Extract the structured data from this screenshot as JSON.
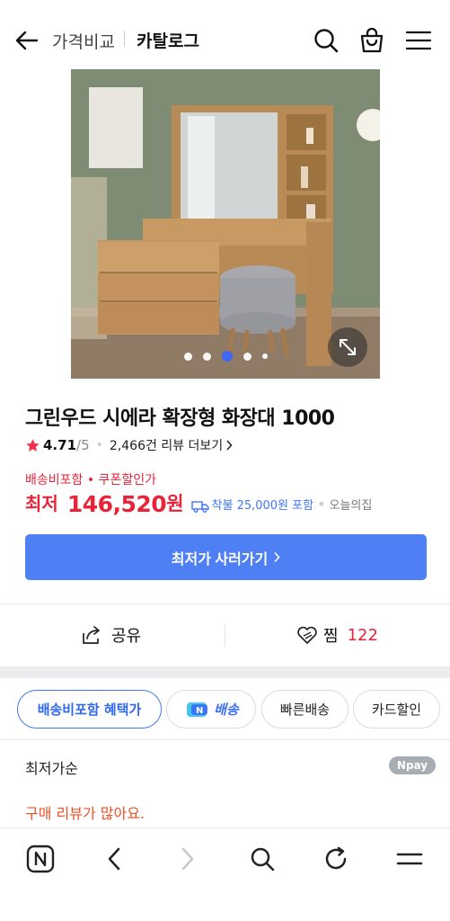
{
  "header": {
    "back_label": "back",
    "crumb_parent": "가격비교",
    "crumb_current": "카탈로그"
  },
  "product": {
    "image_alt": "vanity dresser with stool",
    "carousel_pages": 5,
    "carousel_current": 3,
    "title": "그린우드 시에라 확장형 화장대 1000",
    "rating": "4.71",
    "rating_max": "/5",
    "review_text": "2,466건 리뷰 더보기"
  },
  "price": {
    "note": "배송비포함 • 쿠폰할인가",
    "label": "최저",
    "value": "146,520",
    "unit": "원",
    "shipping": "착불 25,000원 포함",
    "ship_today": "오늘의집",
    "cta_label": "최저가 사러가기"
  },
  "actions": {
    "share_label": "공유",
    "wish_label": "찜",
    "wish_count": "122"
  },
  "filters": {
    "chips": [
      "배송비포함 혜택가",
      "배송",
      "빠른배송",
      "카드할인"
    ],
    "npay_chip_prefix": "N"
  },
  "listing": {
    "sort_label": "최저가순",
    "npay_badge": "Npay",
    "review_hint": "구매 리뷰가 많아요."
  },
  "colors": {
    "accent_blue": "#4f7ff5",
    "price_red": "#e8243a"
  }
}
